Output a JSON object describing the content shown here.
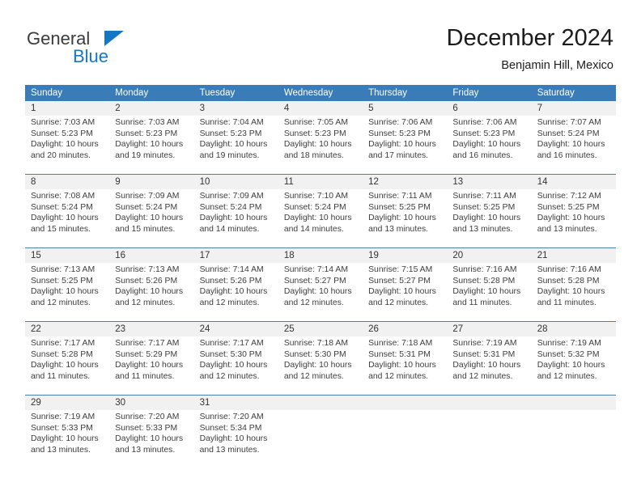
{
  "logo": {
    "word_top": "General",
    "word_bottom": "Blue",
    "icon": "triangle-flag-icon",
    "colors": {
      "blue": "#1577c4",
      "dark": "#3b3b3b"
    }
  },
  "header": {
    "title": "December 2024",
    "location": "Benjamin Hill, Mexico"
  },
  "theme": {
    "header_blue": "#3a7cb8",
    "daynum_band": "#f1f1f1",
    "row_divider": "#4a7fae"
  },
  "calendar": {
    "day_headers": [
      "Sunday",
      "Monday",
      "Tuesday",
      "Wednesday",
      "Thursday",
      "Friday",
      "Saturday"
    ],
    "weeks": [
      {
        "days": [
          {
            "num": "1",
            "sunrise": "Sunrise: 7:03 AM",
            "sunset": "Sunset: 5:23 PM",
            "daylight1": "Daylight: 10 hours",
            "daylight2": "and 20 minutes."
          },
          {
            "num": "2",
            "sunrise": "Sunrise: 7:03 AM",
            "sunset": "Sunset: 5:23 PM",
            "daylight1": "Daylight: 10 hours",
            "daylight2": "and 19 minutes."
          },
          {
            "num": "3",
            "sunrise": "Sunrise: 7:04 AM",
            "sunset": "Sunset: 5:23 PM",
            "daylight1": "Daylight: 10 hours",
            "daylight2": "and 19 minutes."
          },
          {
            "num": "4",
            "sunrise": "Sunrise: 7:05 AM",
            "sunset": "Sunset: 5:23 PM",
            "daylight1": "Daylight: 10 hours",
            "daylight2": "and 18 minutes."
          },
          {
            "num": "5",
            "sunrise": "Sunrise: 7:06 AM",
            "sunset": "Sunset: 5:23 PM",
            "daylight1": "Daylight: 10 hours",
            "daylight2": "and 17 minutes."
          },
          {
            "num": "6",
            "sunrise": "Sunrise: 7:06 AM",
            "sunset": "Sunset: 5:23 PM",
            "daylight1": "Daylight: 10 hours",
            "daylight2": "and 16 minutes."
          },
          {
            "num": "7",
            "sunrise": "Sunrise: 7:07 AM",
            "sunset": "Sunset: 5:24 PM",
            "daylight1": "Daylight: 10 hours",
            "daylight2": "and 16 minutes."
          }
        ]
      },
      {
        "days": [
          {
            "num": "8",
            "sunrise": "Sunrise: 7:08 AM",
            "sunset": "Sunset: 5:24 PM",
            "daylight1": "Daylight: 10 hours",
            "daylight2": "and 15 minutes."
          },
          {
            "num": "9",
            "sunrise": "Sunrise: 7:09 AM",
            "sunset": "Sunset: 5:24 PM",
            "daylight1": "Daylight: 10 hours",
            "daylight2": "and 15 minutes."
          },
          {
            "num": "10",
            "sunrise": "Sunrise: 7:09 AM",
            "sunset": "Sunset: 5:24 PM",
            "daylight1": "Daylight: 10 hours",
            "daylight2": "and 14 minutes."
          },
          {
            "num": "11",
            "sunrise": "Sunrise: 7:10 AM",
            "sunset": "Sunset: 5:24 PM",
            "daylight1": "Daylight: 10 hours",
            "daylight2": "and 14 minutes."
          },
          {
            "num": "12",
            "sunrise": "Sunrise: 7:11 AM",
            "sunset": "Sunset: 5:25 PM",
            "daylight1": "Daylight: 10 hours",
            "daylight2": "and 13 minutes."
          },
          {
            "num": "13",
            "sunrise": "Sunrise: 7:11 AM",
            "sunset": "Sunset: 5:25 PM",
            "daylight1": "Daylight: 10 hours",
            "daylight2": "and 13 minutes."
          },
          {
            "num": "14",
            "sunrise": "Sunrise: 7:12 AM",
            "sunset": "Sunset: 5:25 PM",
            "daylight1": "Daylight: 10 hours",
            "daylight2": "and 13 minutes."
          }
        ]
      },
      {
        "days": [
          {
            "num": "15",
            "sunrise": "Sunrise: 7:13 AM",
            "sunset": "Sunset: 5:25 PM",
            "daylight1": "Daylight: 10 hours",
            "daylight2": "and 12 minutes."
          },
          {
            "num": "16",
            "sunrise": "Sunrise: 7:13 AM",
            "sunset": "Sunset: 5:26 PM",
            "daylight1": "Daylight: 10 hours",
            "daylight2": "and 12 minutes."
          },
          {
            "num": "17",
            "sunrise": "Sunrise: 7:14 AM",
            "sunset": "Sunset: 5:26 PM",
            "daylight1": "Daylight: 10 hours",
            "daylight2": "and 12 minutes."
          },
          {
            "num": "18",
            "sunrise": "Sunrise: 7:14 AM",
            "sunset": "Sunset: 5:27 PM",
            "daylight1": "Daylight: 10 hours",
            "daylight2": "and 12 minutes."
          },
          {
            "num": "19",
            "sunrise": "Sunrise: 7:15 AM",
            "sunset": "Sunset: 5:27 PM",
            "daylight1": "Daylight: 10 hours",
            "daylight2": "and 12 minutes."
          },
          {
            "num": "20",
            "sunrise": "Sunrise: 7:16 AM",
            "sunset": "Sunset: 5:28 PM",
            "daylight1": "Daylight: 10 hours",
            "daylight2": "and 11 minutes."
          },
          {
            "num": "21",
            "sunrise": "Sunrise: 7:16 AM",
            "sunset": "Sunset: 5:28 PM",
            "daylight1": "Daylight: 10 hours",
            "daylight2": "and 11 minutes."
          }
        ]
      },
      {
        "days": [
          {
            "num": "22",
            "sunrise": "Sunrise: 7:17 AM",
            "sunset": "Sunset: 5:28 PM",
            "daylight1": "Daylight: 10 hours",
            "daylight2": "and 11 minutes."
          },
          {
            "num": "23",
            "sunrise": "Sunrise: 7:17 AM",
            "sunset": "Sunset: 5:29 PM",
            "daylight1": "Daylight: 10 hours",
            "daylight2": "and 11 minutes."
          },
          {
            "num": "24",
            "sunrise": "Sunrise: 7:17 AM",
            "sunset": "Sunset: 5:30 PM",
            "daylight1": "Daylight: 10 hours",
            "daylight2": "and 12 minutes."
          },
          {
            "num": "25",
            "sunrise": "Sunrise: 7:18 AM",
            "sunset": "Sunset: 5:30 PM",
            "daylight1": "Daylight: 10 hours",
            "daylight2": "and 12 minutes."
          },
          {
            "num": "26",
            "sunrise": "Sunrise: 7:18 AM",
            "sunset": "Sunset: 5:31 PM",
            "daylight1": "Daylight: 10 hours",
            "daylight2": "and 12 minutes."
          },
          {
            "num": "27",
            "sunrise": "Sunrise: 7:19 AM",
            "sunset": "Sunset: 5:31 PM",
            "daylight1": "Daylight: 10 hours",
            "daylight2": "and 12 minutes."
          },
          {
            "num": "28",
            "sunrise": "Sunrise: 7:19 AM",
            "sunset": "Sunset: 5:32 PM",
            "daylight1": "Daylight: 10 hours",
            "daylight2": "and 12 minutes."
          }
        ]
      },
      {
        "days": [
          {
            "num": "29",
            "sunrise": "Sunrise: 7:19 AM",
            "sunset": "Sunset: 5:33 PM",
            "daylight1": "Daylight: 10 hours",
            "daylight2": "and 13 minutes."
          },
          {
            "num": "30",
            "sunrise": "Sunrise: 7:20 AM",
            "sunset": "Sunset: 5:33 PM",
            "daylight1": "Daylight: 10 hours",
            "daylight2": "and 13 minutes."
          },
          {
            "num": "31",
            "sunrise": "Sunrise: 7:20 AM",
            "sunset": "Sunset: 5:34 PM",
            "daylight1": "Daylight: 10 hours",
            "daylight2": "and 13 minutes."
          },
          {
            "num": "",
            "sunrise": "",
            "sunset": "",
            "daylight1": "",
            "daylight2": ""
          },
          {
            "num": "",
            "sunrise": "",
            "sunset": "",
            "daylight1": "",
            "daylight2": ""
          },
          {
            "num": "",
            "sunrise": "",
            "sunset": "",
            "daylight1": "",
            "daylight2": ""
          },
          {
            "num": "",
            "sunrise": "",
            "sunset": "",
            "daylight1": "",
            "daylight2": ""
          }
        ]
      }
    ]
  }
}
